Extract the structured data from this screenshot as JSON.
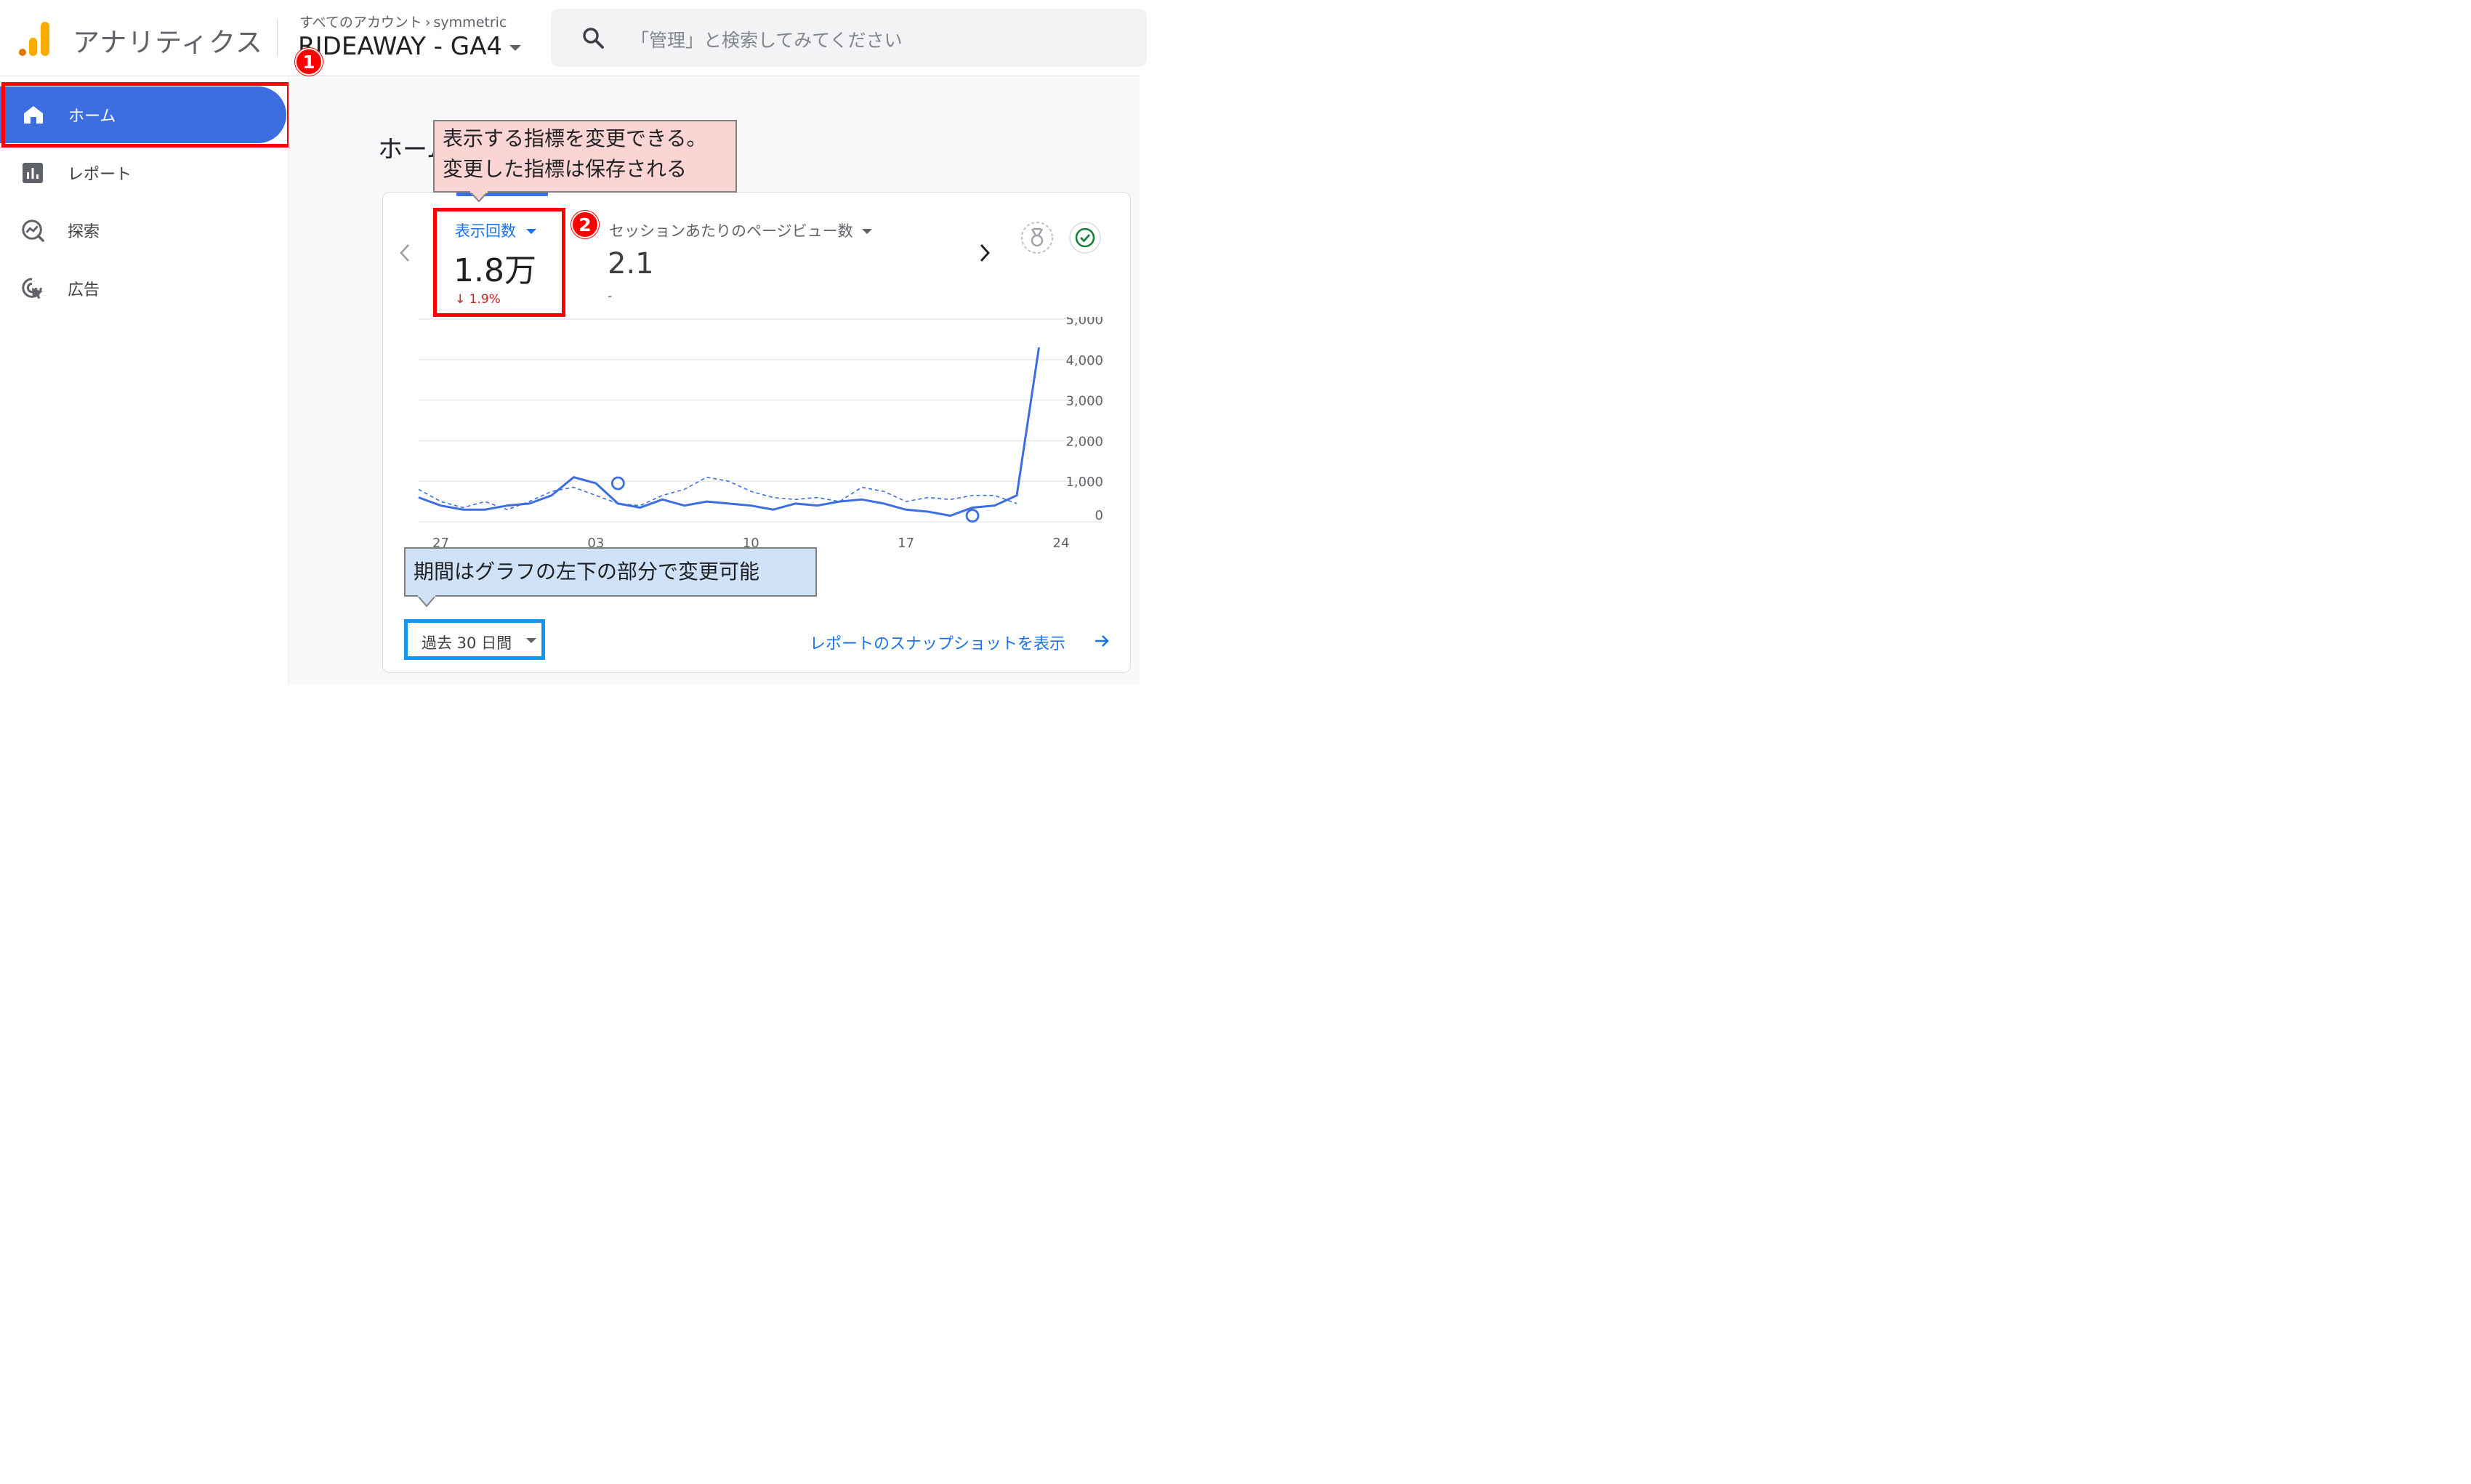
{
  "header": {
    "app_title": "アナリティクス",
    "breadcrumb_all": "すべてのアカウント",
    "breadcrumb_account": "symmetric",
    "property": "RIDEAWAY - GA4",
    "search_placeholder": "「管理」と検索してみてください"
  },
  "sidebar": {
    "items": [
      {
        "label": "ホーム",
        "icon": "home-icon",
        "active": true
      },
      {
        "label": "レポート",
        "icon": "bar-chart-icon"
      },
      {
        "label": "探索",
        "icon": "explore-icon"
      },
      {
        "label": "広告",
        "icon": "ads-icon"
      }
    ]
  },
  "main": {
    "page_title": "ホーム",
    "metrics": [
      {
        "label": "表示回数",
        "value": "1.8万",
        "change": "↓ 1.9%"
      },
      {
        "label": "セッションあたりのページビュー数",
        "value": "2.1",
        "change": "-"
      }
    ],
    "date_range": "過去 30 日間",
    "snapshot_link": "レポートのスナップショットを表示"
  },
  "annotations": {
    "badge1": "1",
    "badge2": "2",
    "callout_metric_line1": "表示する指標を変更できる。",
    "callout_metric_line2": "変更した指標は保存される",
    "callout_period": "期間はグラフの左下の部分で変更可能"
  },
  "colors": {
    "accent": "#3c6edf",
    "highlight_red": "#ff0000",
    "highlight_blue": "#1296f0",
    "line": "#3c6edf",
    "negative": "#c5221f"
  },
  "chart_data": {
    "type": "line",
    "x": [
      1,
      2,
      3,
      4,
      5,
      6,
      7,
      8,
      9,
      10,
      11,
      12,
      13,
      14,
      15,
      16,
      17,
      18,
      19,
      20,
      21,
      22,
      23,
      24,
      25,
      26,
      27,
      28,
      29,
      30
    ],
    "x_tick_labels": [
      "27",
      "03",
      "10",
      "17",
      "24"
    ],
    "x_tick_positions": [
      2,
      9,
      16,
      23,
      30
    ],
    "y_tick_labels": [
      "5,000",
      "4,000",
      "3,000",
      "2,000",
      "1,000",
      "0"
    ],
    "ylim": [
      0,
      5000
    ],
    "grid": true,
    "series": [
      {
        "style": "solid",
        "values": [
          600,
          400,
          300,
          300,
          400,
          450,
          650,
          1100,
          950,
          450,
          350,
          550,
          400,
          500,
          450,
          400,
          300,
          450,
          400,
          500,
          550,
          450,
          300,
          250,
          150,
          350,
          400,
          650,
          4300
        ]
      },
      {
        "style": "dashed",
        "values": [
          800,
          500,
          350,
          500,
          300,
          500,
          750,
          850,
          650,
          450,
          400,
          650,
          800,
          1100,
          1000,
          750,
          600,
          550,
          600,
          500,
          850,
          750,
          500,
          600,
          550,
          650,
          650,
          450
        ]
      }
    ],
    "markers": [
      {
        "series": 0,
        "x": 10,
        "value": 950
      },
      {
        "series": 0,
        "x": 26,
        "value": 150
      }
    ]
  }
}
